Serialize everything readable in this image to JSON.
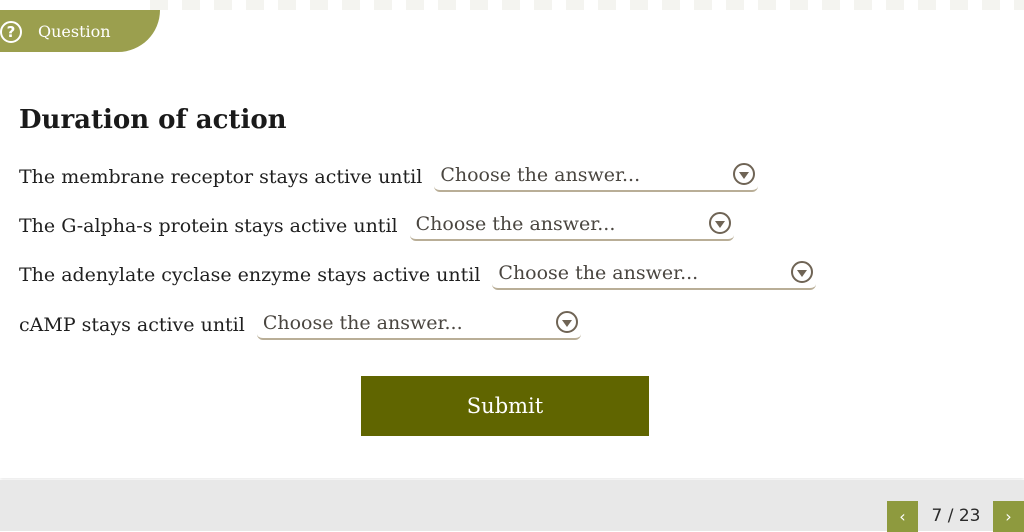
{
  "header": {
    "tab_label": "Question",
    "icon": "question-circle-icon"
  },
  "title": "Duration of action",
  "rows": [
    {
      "label": "The membrane receptor stays active until",
      "placeholder": "Choose the answer..."
    },
    {
      "label": "The G-alpha-s protein stays active until",
      "placeholder": "Choose the answer..."
    },
    {
      "label": "The adenylate cyclase enzyme stays active until",
      "placeholder": "Choose the answer..."
    },
    {
      "label": "cAMP stays active until",
      "placeholder": "Choose the answer..."
    }
  ],
  "submit_label": "Submit",
  "pagination": {
    "current": 7,
    "total": 23,
    "text": "7 / 23",
    "prev_icon": "‹",
    "next_icon": "›"
  },
  "colors": {
    "tab": "#9b9f4e",
    "submit": "#606500",
    "nav": "#8e9a3e"
  }
}
